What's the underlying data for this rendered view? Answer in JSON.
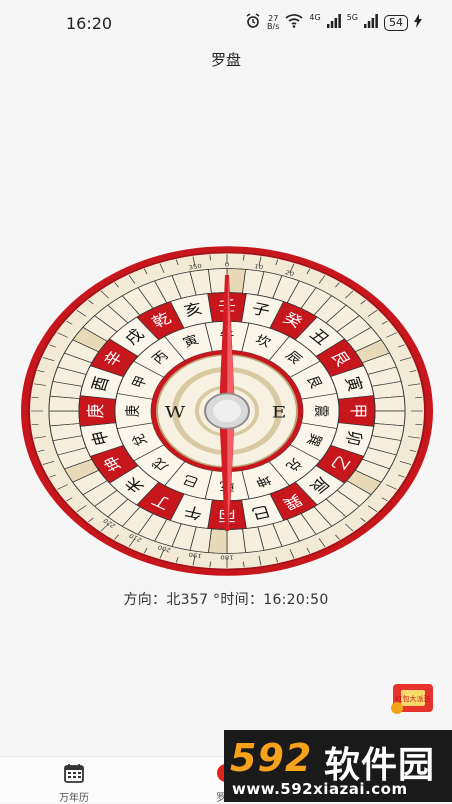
{
  "status_bar": {
    "time": "16:20",
    "net_speed_value": "27",
    "net_speed_unit": "B/s",
    "net_a": "4G",
    "net_b": "5G",
    "battery": "54"
  },
  "header": {
    "title": "罗盘"
  },
  "compass": {
    "east_label": "E",
    "west_label": "W",
    "ring_mountains": [
      "壬",
      "子",
      "癸",
      "丑",
      "艮",
      "寅",
      "甲",
      "卯",
      "乙",
      "辰",
      "巽",
      "巳",
      "丙",
      "午",
      "丁",
      "未",
      "坤",
      "申",
      "庚",
      "酉",
      "辛",
      "戌",
      "乾",
      "亥"
    ],
    "inner_ring": [
      "午",
      "坎",
      "辰",
      "艮",
      "震",
      "巽",
      "兑",
      "坤",
      "乾",
      "巳",
      "戊",
      "兌",
      "庚",
      "甲",
      "丙",
      "寅"
    ],
    "degree_labels": [
      "350",
      "0",
      "10",
      "20",
      "180",
      "190",
      "200",
      "210",
      "220"
    ]
  },
  "readout": {
    "direction_label": "方向：",
    "direction_value": "北357 °",
    "time_label": "时间：",
    "time_value": "16:20:50"
  },
  "bottom_nav": {
    "items": [
      {
        "label": "万年历",
        "icon": "calendar-icon"
      },
      {
        "label": "罗盘",
        "icon": "compass-icon"
      }
    ]
  },
  "promo": {
    "text": "红包大派送"
  },
  "watermark": {
    "number": "592",
    "brand": "软件园",
    "url": "www.592xiazai.com"
  },
  "colors": {
    "compass_red": "#c8161d",
    "compass_cream": "#f3ead6",
    "watermark_orange": "#f7a21b"
  }
}
